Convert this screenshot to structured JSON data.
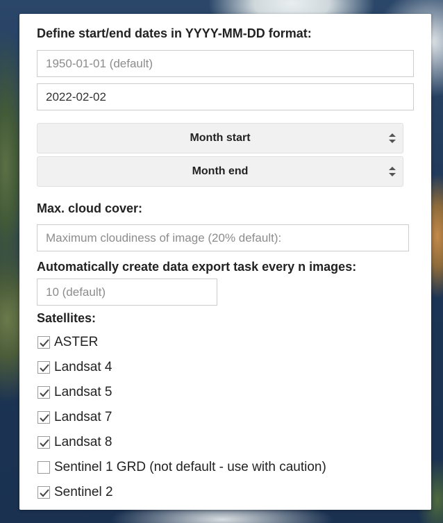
{
  "dates": {
    "heading": "Define start/end dates in YYYY-MM-DD format:",
    "start_placeholder": "1950-01-01 (default)",
    "end_value": "2022-02-02"
  },
  "month_selects": {
    "start_label": "Month start",
    "end_label": "Month end"
  },
  "cloud": {
    "heading": "Max. cloud cover:",
    "placeholder": "Maximum cloudiness of image (20% default):"
  },
  "export": {
    "heading": "Automatically create data export task every n images:",
    "placeholder": "10 (default)"
  },
  "satellites": {
    "heading": "Satellites:",
    "items": [
      {
        "label": "ASTER",
        "checked": true
      },
      {
        "label": "Landsat 4",
        "checked": true
      },
      {
        "label": "Landsat 5",
        "checked": true
      },
      {
        "label": "Landsat 7",
        "checked": true
      },
      {
        "label": "Landsat 8",
        "checked": true
      },
      {
        "label": "Sentinel 1 GRD (not default - use with caution)",
        "checked": false
      },
      {
        "label": "Sentinel 2",
        "checked": true
      }
    ]
  },
  "icons": {
    "select_arrow": "up-down-arrows-icon",
    "checkmark": "checkmark-icon"
  }
}
